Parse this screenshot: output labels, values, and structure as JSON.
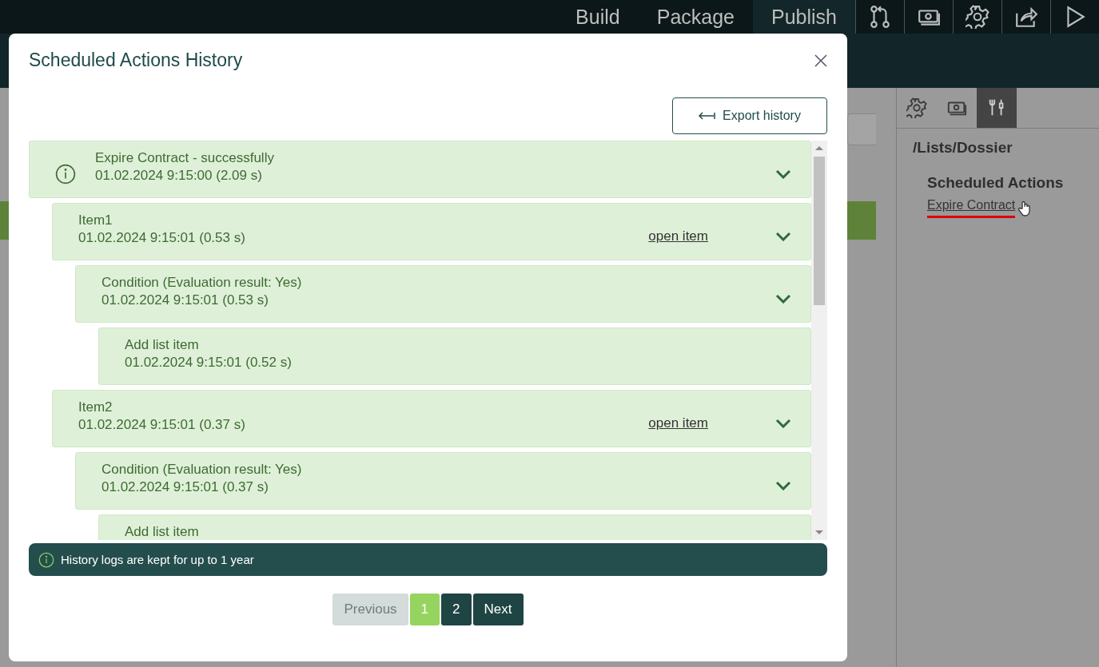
{
  "top_nav": {
    "tabs": [
      {
        "label": "Build",
        "selected": false
      },
      {
        "label": "Package",
        "selected": false
      },
      {
        "label": "Publish",
        "selected": true
      }
    ],
    "tools": [
      {
        "kind": "branch"
      },
      {
        "kind": "money"
      },
      {
        "kind": "gear"
      },
      {
        "kind": "share"
      },
      {
        "kind": "play"
      }
    ]
  },
  "side_panel": {
    "tabs": [
      {
        "kind": "gear",
        "selected": false
      },
      {
        "kind": "money",
        "selected": false
      },
      {
        "kind": "tools",
        "selected": true
      }
    ],
    "path": "/Lists/Dossier",
    "section_title": "Scheduled Actions",
    "link": "Expire Contract"
  },
  "modal": {
    "title": "Scheduled Actions History",
    "export_button": "Export history",
    "entries": [
      {
        "title": "Expire Contract - successfully",
        "time": "01.02.2024 9:15:00 (2.09 s)",
        "info": true,
        "children": [
          {
            "title": "Item1",
            "time": "01.02.2024 9:15:01 (0.53 s)",
            "link": "open item",
            "children": [
              {
                "title": "Condition (Evaluation result: Yes)",
                "time": "01.02.2024 9:15:01 (0.53 s)",
                "children": [
                  {
                    "title": "Add list item",
                    "time": "01.02.2024 9:15:01 (0.52 s)"
                  }
                ]
              }
            ]
          },
          {
            "title": "Item2",
            "time": "01.02.2024 9:15:01 (0.37 s)",
            "link": "open item",
            "children": [
              {
                "title": "Condition (Evaluation result: Yes)",
                "time": "01.02.2024 9:15:01 (0.37 s)",
                "children": [
                  {
                    "title": "Add list item"
                  }
                ]
              }
            ]
          }
        ]
      }
    ],
    "notice": "History logs are kept for up to 1 year",
    "pagination": {
      "previous": {
        "label": "Previous",
        "disabled": true
      },
      "pages": [
        {
          "label": "1",
          "selected": true
        },
        {
          "label": "2",
          "selected": false
        }
      ],
      "next": {
        "label": "Next",
        "disabled": false
      }
    }
  }
}
